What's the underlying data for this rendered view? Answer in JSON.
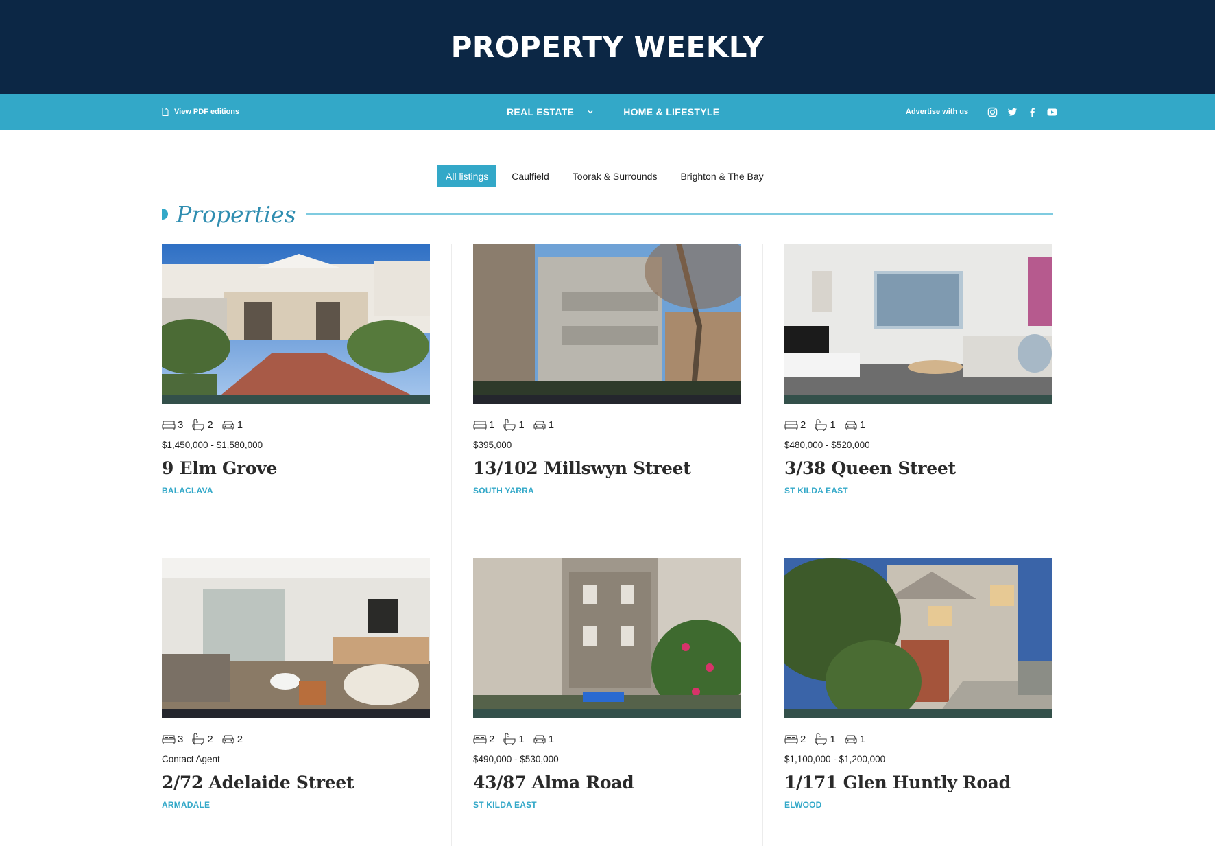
{
  "site": {
    "title": "PROPERTY WEEKLY"
  },
  "nav": {
    "pdf_label": "View PDF editions",
    "items": [
      {
        "label": "REAL ESTATE"
      },
      {
        "label": "HOME & LIFESTYLE"
      }
    ],
    "advertise_label": "Advertise with us",
    "social": [
      "instagram-icon",
      "twitter-icon",
      "facebook-icon",
      "youtube-icon"
    ]
  },
  "filters": [
    {
      "label": "All listings",
      "active": true
    },
    {
      "label": "Caulfield",
      "active": false
    },
    {
      "label": "Toorak & Surrounds",
      "active": false
    },
    {
      "label": "Brighton & The Bay",
      "active": false
    }
  ],
  "section": {
    "title": "Properties"
  },
  "listings": [
    {
      "beds": "3",
      "baths": "2",
      "cars": "1",
      "price": "$1,450,000 - $1,580,000",
      "address": "9 Elm Grove",
      "suburb": "BALACLAVA"
    },
    {
      "beds": "1",
      "baths": "1",
      "cars": "1",
      "price": "$395,000",
      "address": "13/102 Millswyn Street",
      "suburb": "SOUTH YARRA"
    },
    {
      "beds": "2",
      "baths": "1",
      "cars": "1",
      "price": "$480,000 - $520,000",
      "address": "3/38 Queen Street",
      "suburb": "ST KILDA EAST"
    },
    {
      "beds": "3",
      "baths": "2",
      "cars": "2",
      "price": "Contact Agent",
      "address": "2/72 Adelaide Street",
      "suburb": "ARMADALE"
    },
    {
      "beds": "2",
      "baths": "1",
      "cars": "1",
      "price": "$490,000 - $530,000",
      "address": "43/87 Alma Road",
      "suburb": "ST KILDA EAST"
    },
    {
      "beds": "2",
      "baths": "1",
      "cars": "1",
      "price": "$1,100,000 - $1,200,000",
      "address": "1/171 Glen Huntly Road",
      "suburb": "ELWOOD"
    }
  ],
  "colors": {
    "navy": "#0c2745",
    "accent": "#33a8c8",
    "band": "#33504a"
  }
}
